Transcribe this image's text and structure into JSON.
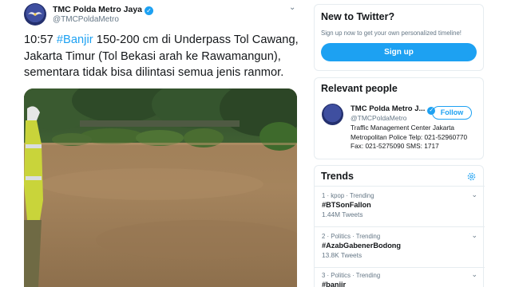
{
  "tweet": {
    "author_name": "TMC Polda Metro Jaya",
    "author_handle": "@TMCPoldaMetro",
    "text_time": "10:57",
    "text_hashtag": "#Banjir",
    "text_rest": " 150-200 cm di Underpass Tol Cawang, Jakarta Timur (Tol Bekasi arah ke Rawamangun), sementara tidak bisa dilintasi semua jenis ranmor."
  },
  "new_to_twitter": {
    "title": "New to Twitter?",
    "subtitle": "Sign up now to get your own personalized timeline!",
    "signup_label": "Sign up"
  },
  "relevant_people": {
    "title": "Relevant people",
    "name": "TMC Polda Metro J...",
    "handle": "@TMCPoldaMetro",
    "follow_label": "Follow",
    "bio": "Traffic Management Center Jakarta Metropolitan Police Telp: 021-52960770 Fax: 021-5275090 SMS: 1717"
  },
  "trends": {
    "title": "Trends",
    "items": [
      {
        "context": "1 · kpop · Trending",
        "name": "#BTSonFallon",
        "count": "1.44M Tweets"
      },
      {
        "context": "2 · Politics · Trending",
        "name": "#AzabGabenerBodong",
        "count": "13.8K Tweets"
      },
      {
        "context": "3 · Politics · Trending",
        "name": "#banjir",
        "count": ""
      }
    ]
  },
  "colors": {
    "accent": "#1da1f2",
    "text": "#14171a",
    "secondary": "#657786"
  },
  "icons": [
    "verified-badge-icon",
    "chevron-down-icon",
    "gear-icon"
  ]
}
